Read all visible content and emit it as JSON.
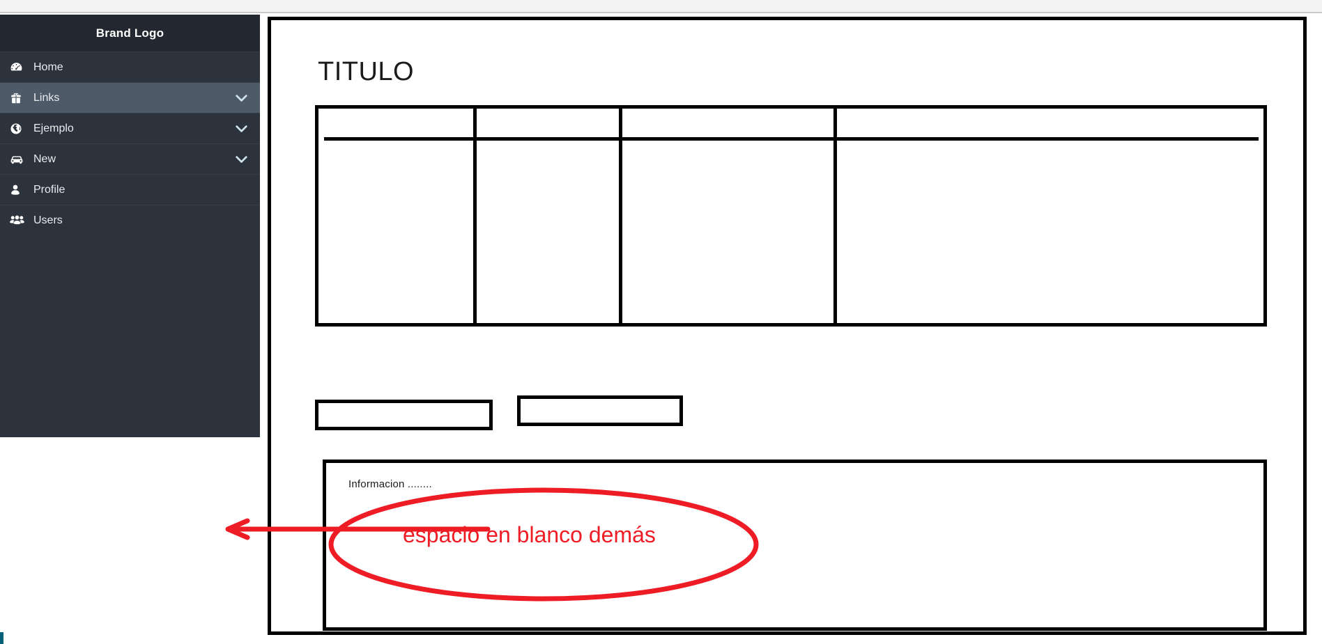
{
  "browser": {
    "top_strip": ""
  },
  "sidebar": {
    "brand": "Brand Logo",
    "items": [
      {
        "label": "Home",
        "icon": "dashboard-icon",
        "active": false,
        "chevron": false
      },
      {
        "label": "Links",
        "icon": "gift-icon",
        "active": true,
        "chevron": true
      },
      {
        "label": "Ejemplo",
        "icon": "globe-icon",
        "active": false,
        "chevron": true
      },
      {
        "label": "New",
        "icon": "car-icon",
        "active": false,
        "chevron": true
      },
      {
        "label": "Profile",
        "icon": "user-icon",
        "active": false,
        "chevron": false
      },
      {
        "label": "Users",
        "icon": "users-icon",
        "active": false,
        "chevron": false
      }
    ]
  },
  "main": {
    "title": "TITULO",
    "table": {
      "columns": 4,
      "header_row": true,
      "cells": [
        [
          "",
          "",
          "",
          ""
        ],
        [
          "",
          "",
          "",
          ""
        ]
      ]
    },
    "boxes": [
      {
        "name": "input-box-left",
        "value": ""
      },
      {
        "name": "input-box-right",
        "value": ""
      }
    ],
    "info_panel": {
      "text": "Informacion ........"
    }
  },
  "annotation": {
    "text": "espacio en blanco demás",
    "color": "#ee1c25",
    "shape": "ellipse-with-arrow",
    "arrow_direction": "left"
  },
  "colors": {
    "sidebar_bg": "#2d333c",
    "sidebar_brand_bg": "#232730",
    "sidebar_active_bg": "#4e5a68",
    "sidebar_text": "#e9ecef",
    "chevron": "#cfe3ef",
    "wireframe_stroke": "#000000",
    "annotation_red": "#ee1c25",
    "top_strip": "#f3f3f3",
    "teal_caret": "#00607a"
  }
}
